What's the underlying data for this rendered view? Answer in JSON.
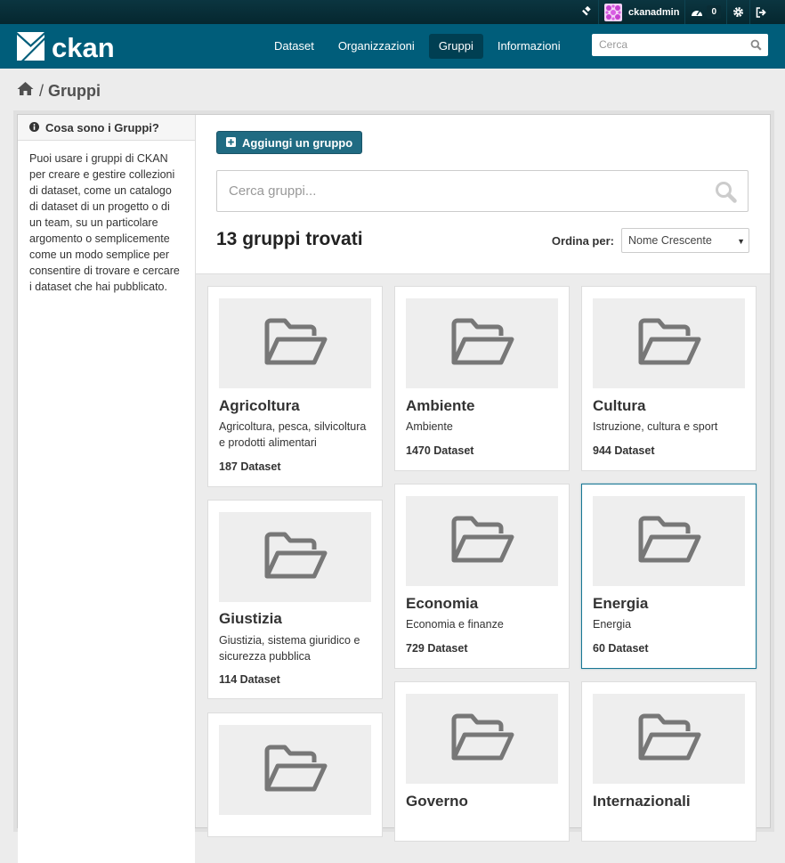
{
  "account": {
    "username": "ckanadmin",
    "activity_count": "0"
  },
  "masthead": {
    "logo_text": "ckan",
    "nav": [
      {
        "label": "Dataset"
      },
      {
        "label": "Organizzazioni"
      },
      {
        "label": "Gruppi"
      },
      {
        "label": "Informazioni"
      }
    ],
    "search_placeholder": "Cerca"
  },
  "breadcrumb": {
    "current": "Gruppi"
  },
  "sidebar": {
    "heading": "Cosa sono i Gruppi?",
    "body": "Puoi usare i gruppi di CKAN per creare e gestire collezioni di dataset, come un catalogo di dataset di un progetto o di un team, su un particolare argomento o semplicemente come un modo semplice per consentire di trovare e cercare i dataset che hai pubblicato."
  },
  "main": {
    "add_button": "Aggiungi un gruppo",
    "search_placeholder": "Cerca gruppi...",
    "results_count": "13 gruppi trovati",
    "sort_label": "Ordina per:",
    "sort_value": "Nome Crescente"
  },
  "groups": [
    {
      "title": "Agricoltura",
      "description": "Agricoltura, pesca, silvicoltura e prodotti alimentari",
      "datasets": "187 Dataset"
    },
    {
      "title": "Ambiente",
      "description": "Ambiente",
      "datasets": "1470 Dataset"
    },
    {
      "title": "Cultura",
      "description": "Istruzione, cultura e sport",
      "datasets": "944 Dataset"
    },
    {
      "title": "Giustizia",
      "description": "Giustizia, sistema giuridico e sicurezza pubblica",
      "datasets": "114 Dataset"
    },
    {
      "title": "Economia",
      "description": "Economia e finanze",
      "datasets": "729 Dataset"
    },
    {
      "title": "Energia",
      "description": "Energia",
      "datasets": "60 Dataset"
    },
    {
      "title": "",
      "description": "",
      "datasets": ""
    },
    {
      "title": "Governo",
      "description": "",
      "datasets": ""
    },
    {
      "title": "Internazionali",
      "description": "",
      "datasets": ""
    }
  ],
  "colors": {
    "masthead": "#005d7a",
    "account_bar": "#05272f",
    "primary_button": "#206b82",
    "active_nav": "#003f52"
  }
}
